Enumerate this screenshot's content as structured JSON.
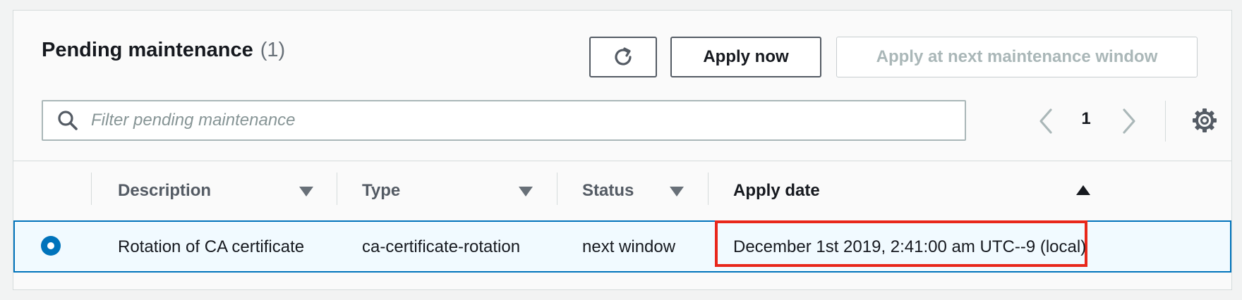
{
  "header": {
    "title": "Pending maintenance",
    "count": "(1)"
  },
  "actions": {
    "refresh_icon": "refresh-icon",
    "apply_now": "Apply now",
    "apply_next": "Apply at next maintenance window"
  },
  "filter": {
    "placeholder": "Filter pending maintenance",
    "value": ""
  },
  "pagination": {
    "current_page": "1"
  },
  "table": {
    "columns": [
      "Description",
      "Type",
      "Status",
      "Apply date"
    ],
    "rows": [
      {
        "selected": true,
        "description": "Rotation of CA certificate",
        "type": "ca-certificate-rotation",
        "status": "next window",
        "apply_date": "December 1st 2019, 2:41:00 am UTC--9 (local)"
      }
    ]
  },
  "colors": {
    "accent": "#0073bb",
    "highlight": "#e8271b",
    "selected_row_bg": "#f1faff"
  }
}
